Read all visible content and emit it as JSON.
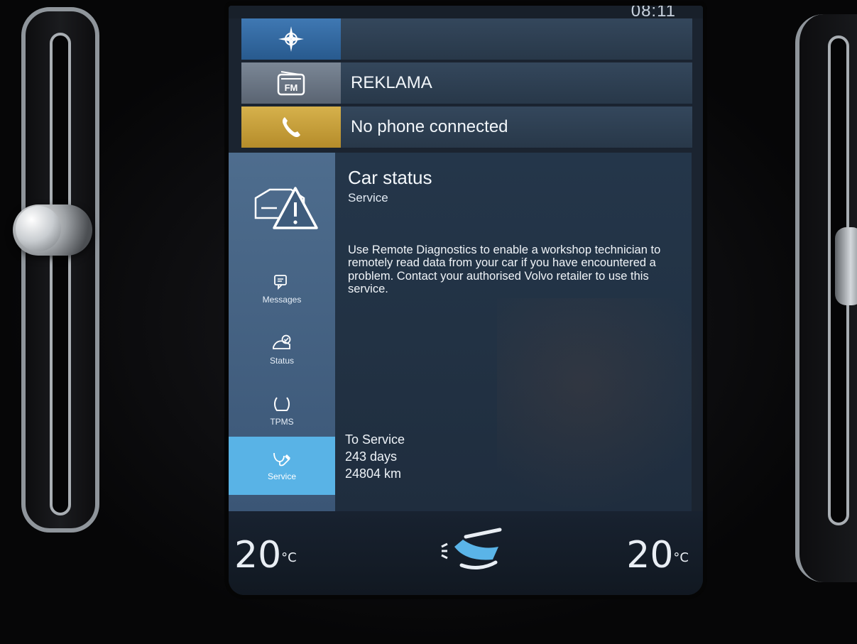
{
  "status_bar": {
    "clock": "08:11"
  },
  "tiles": {
    "navigation": {
      "label": ""
    },
    "radio": {
      "label": "REKLAMA",
      "icon_text": "FM"
    },
    "phone": {
      "label": "No phone connected"
    }
  },
  "app": {
    "title": "Car status",
    "subtitle": "Service",
    "description": "Use Remote Diagnostics to enable a workshop technician to remotely read data from your car if you have encountered a problem. Contact your authorised Volvo retailer to use this service.",
    "sidebar": [
      {
        "label": "Messages",
        "icon": "messages-icon"
      },
      {
        "label": "Status",
        "icon": "status-icon"
      },
      {
        "label": "TPMS",
        "icon": "tpms-icon"
      },
      {
        "label": "Service",
        "icon": "service-icon",
        "active": true
      }
    ],
    "service_info": {
      "heading": "To Service",
      "days": "243 days",
      "distance": "24804 km"
    }
  },
  "climate": {
    "left_temp": "20",
    "right_temp": "20",
    "unit": "°C"
  },
  "colors": {
    "nav_accent": "#3f78b3",
    "radio_accent": "#7b8796",
    "phone_accent": "#d6b14c",
    "sidebar": "#4e6d8e",
    "active_tab": "#59b3e6"
  }
}
